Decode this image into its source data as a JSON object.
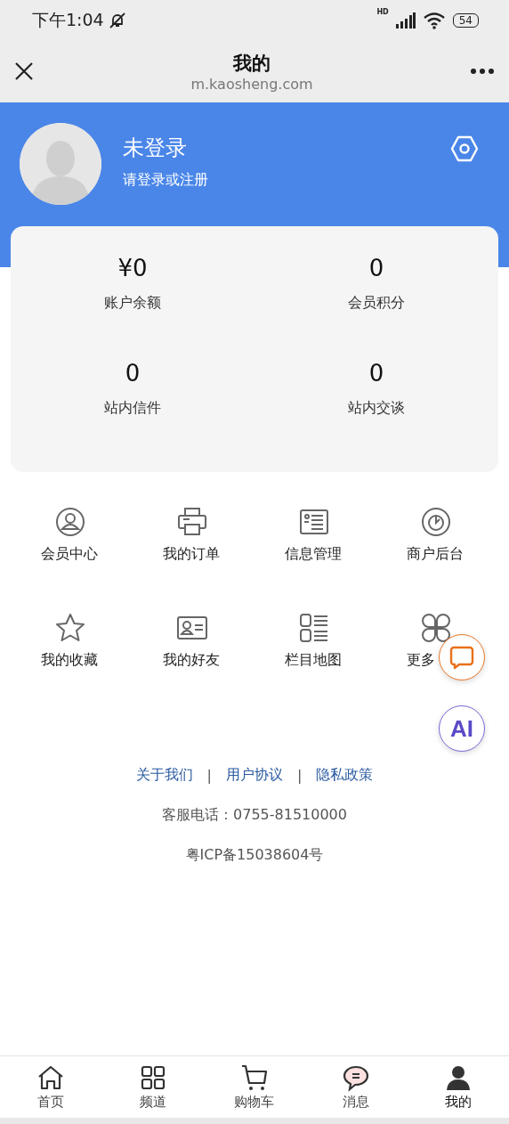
{
  "status_bar": {
    "time": "下午1:04",
    "network": "HD",
    "battery": "54"
  },
  "nav": {
    "title": "我的",
    "url": "m.kaosheng.com"
  },
  "profile": {
    "name": "未登录",
    "hint": "请登录或注册"
  },
  "stats": [
    {
      "value": "¥0",
      "label": "账户余额"
    },
    {
      "value": "0",
      "label": "会员积分"
    },
    {
      "value": "0",
      "label": "站内信件"
    },
    {
      "value": "0",
      "label": "站内交谈"
    }
  ],
  "menu": [
    {
      "label": "会员中心"
    },
    {
      "label": "我的订单"
    },
    {
      "label": "信息管理"
    },
    {
      "label": "商户后台"
    },
    {
      "label": "我的收藏"
    },
    {
      "label": "我的好友"
    },
    {
      "label": "栏目地图"
    },
    {
      "label": "更多"
    }
  ],
  "footer": {
    "links": [
      "关于我们",
      "用户协议",
      "隐私政策"
    ],
    "separators": [
      "|",
      "|"
    ],
    "phone": "客服电话：0755-81510000",
    "icp": "粤ICP备15038604号"
  },
  "ai_button": {
    "label": "AI"
  },
  "tab_bar": [
    {
      "label": "首页",
      "selected": false
    },
    {
      "label": "频道",
      "selected": false
    },
    {
      "label": "购物车",
      "selected": false
    },
    {
      "label": "消息",
      "selected": false
    },
    {
      "label": "我的",
      "selected": true
    }
  ]
}
